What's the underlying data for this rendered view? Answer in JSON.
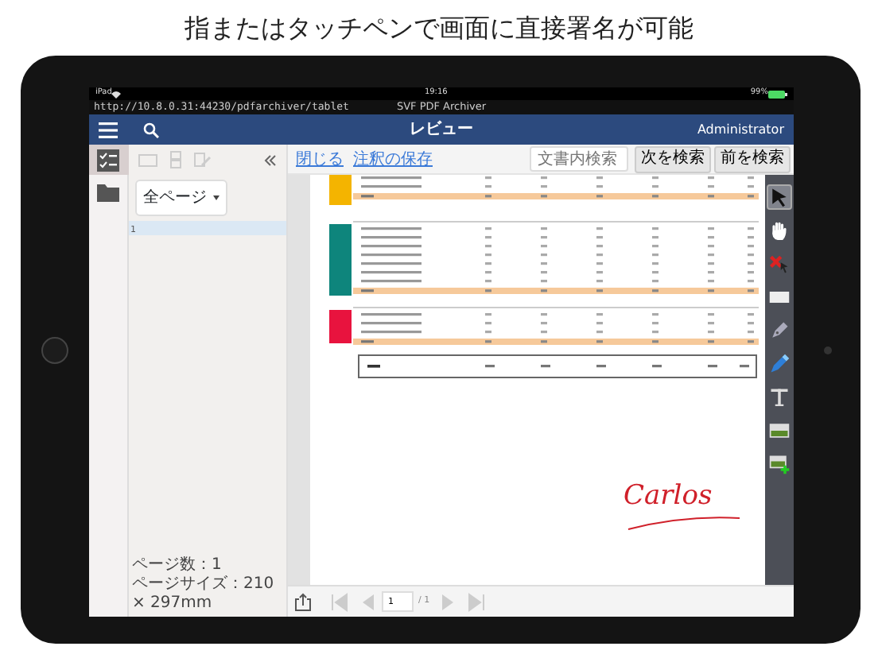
{
  "headline": "指またはタッチペンで画面に直接署名が可能",
  "status_bar": {
    "carrier": "iPad",
    "time": "19:16",
    "battery": "99%"
  },
  "browser": {
    "url": "http://10.8.0.31:44230/pdfarchiver/tablet",
    "title": "SVF PDF Archiver"
  },
  "navbar": {
    "title": "レビュー",
    "user": "Administrator"
  },
  "rail": [
    {
      "kind": "checklist",
      "selected": true
    },
    {
      "kind": "folder",
      "selected": false
    }
  ],
  "sidebar": {
    "page_filter": "全ページ",
    "pages": [
      {
        "label": "1",
        "selected": true
      }
    ],
    "page_count": "ページ数：1",
    "page_size": "ページサイズ：210 × 297mm"
  },
  "toolbar": {
    "links": [
      "閉じる",
      "注釈の保存"
    ],
    "search": {
      "placeholder": "文書内検索"
    },
    "buttons": [
      "次を検索",
      "前を検索"
    ]
  },
  "tools": [
    {
      "kind": "pointer",
      "selected": true
    },
    {
      "kind": "hand",
      "selected": false
    },
    {
      "kind": "eraser",
      "selected": false
    },
    {
      "kind": "rectangle",
      "selected": false
    },
    {
      "kind": "pen",
      "selected": false
    },
    {
      "kind": "marker",
      "selected": false
    },
    {
      "kind": "text",
      "selected": false
    },
    {
      "kind": "image",
      "selected": false
    },
    {
      "kind": "add-image",
      "selected": false
    }
  ],
  "signature": "Carlos",
  "pager": {
    "page": "1",
    "total": "/ 1",
    "buttons": [
      {
        "kind": "first",
        "disabled": true
      },
      {
        "kind": "prev",
        "disabled": true
      },
      {
        "kind": "next",
        "disabled": true
      },
      {
        "kind": "last",
        "disabled": true
      }
    ]
  }
}
